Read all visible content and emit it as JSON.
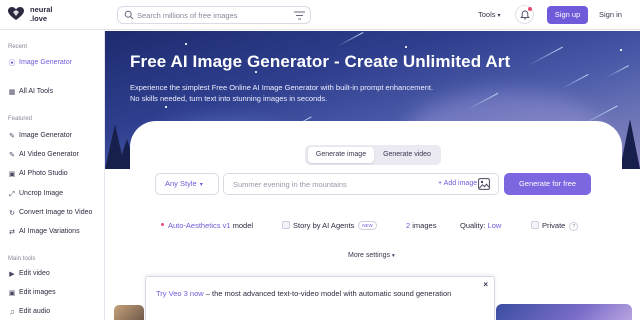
{
  "brand": {
    "line1": "neural",
    "line2": ".love",
    "logo_icon": "heart-logo-icon",
    "logo_color": "#2d2a40"
  },
  "header": {
    "search_placeholder": "Search millions of free images",
    "tools_label": "Tools",
    "signup_label": "Sign up",
    "signin_label": "Sign in"
  },
  "sidebar": {
    "recent_label": "Recent",
    "recent_items": [
      {
        "label": "Image Generator",
        "icon": "image-generator-icon",
        "active": true
      },
      {
        "label": "All AI Tools",
        "icon": "grid-icon"
      }
    ],
    "featured_label": "Featured",
    "featured_items": [
      {
        "label": "Image Generator",
        "icon": "image-generator-icon"
      },
      {
        "label": "AI Video Generator",
        "icon": "video-icon"
      },
      {
        "label": "AI Photo Studio",
        "icon": "camera-icon"
      },
      {
        "label": "Uncrop Image",
        "icon": "expand-icon"
      },
      {
        "label": "Convert Image to Video",
        "icon": "convert-icon"
      },
      {
        "label": "AI Image Variations",
        "icon": "variations-icon"
      }
    ],
    "main_tools_label": "Main tools",
    "main_tools_items": [
      {
        "label": "Edit video",
        "icon": "edit-video-icon"
      },
      {
        "label": "Edit images",
        "icon": "edit-images-icon"
      },
      {
        "label": "Edit audio",
        "icon": "edit-audio-icon"
      }
    ]
  },
  "hero": {
    "title": "Free AI Image Generator - Create Unlimited Art",
    "subtitle_line1": "Experience the simplest Free Online AI Image Generator with built-in prompt enhancement.",
    "subtitle_line2": "No skills needed, turn text into stunning images in seconds."
  },
  "generator": {
    "tabs": [
      {
        "label": "Generate image",
        "active": true
      },
      {
        "label": "Generate video",
        "active": false
      }
    ],
    "style_select": "Any Style",
    "prompt_placeholder": "Summer evening in the mountains",
    "add_image_label": "+ Add image",
    "generate_label": "Generate for free",
    "options": {
      "aesthetics": "Auto-Aesthetics v1",
      "aesthetics_suffix": "model",
      "story_label": "Story by AI Agents",
      "story_badge": "NEW",
      "images_count": "2",
      "images_label": "images",
      "quality_label": "Quality:",
      "quality_value": "Low",
      "private_label": "Private",
      "private_help": "?"
    },
    "more_settings_label": "More settings"
  },
  "toast": {
    "link_text": "Try Veo 3 now",
    "text": " – the most advanced text-to-video model with automatic sound generation",
    "close_label": "×"
  },
  "colors": {
    "accent": "#6f5bd9",
    "generate_button": "#7d66e0",
    "hero_top": "#1d2b6e",
    "hero_bottom": "#8c86c0"
  }
}
